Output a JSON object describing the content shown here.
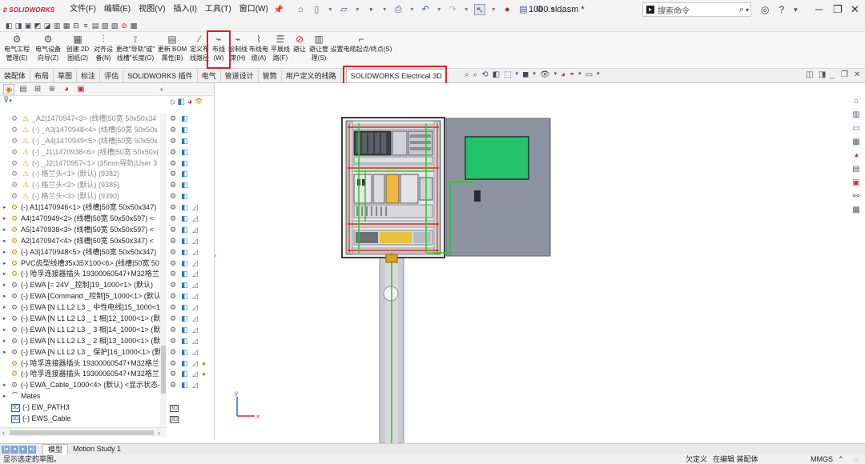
{
  "app": {
    "logo_text": "SOLIDWORKS",
    "document_title": "1000.sldasm *",
    "menus": [
      "文件(F)",
      "编辑(E)",
      "视图(V)",
      "插入(I)",
      "工具(T)",
      "窗口(W)"
    ],
    "search_placeholder": "搜索命令"
  },
  "ribbon": {
    "buttons": [
      {
        "label1": "电气工程",
        "label2": "管理(E)",
        "icon": "project-manager-icon"
      },
      {
        "label1": "电气设备",
        "label2": "向导(Z)",
        "icon": "device-wizard-icon"
      },
      {
        "label1": "创建 2D",
        "label2": "图纸(2)",
        "icon": "create-2d-drawing-icon"
      },
      {
        "label1": "对齐设",
        "label2": "备(N)",
        "icon": "align-device-icon"
      },
      {
        "label1": "更改\"导轨\"或\"",
        "label2": "线槽\"长度(G)",
        "icon": "change-length-icon"
      },
      {
        "label1": "更新 BOM",
        "label2": "属性(B)",
        "icon": "update-bom-icon"
      },
      {
        "label1": "定义布",
        "label2": "线路径",
        "icon": "define-route-icon"
      },
      {
        "label1": "布线",
        "label2": "(W)",
        "icon": "route-wires-icon"
      },
      {
        "label1": "绘制线",
        "label2": "束(H)",
        "icon": "draw-harness-icon"
      },
      {
        "label1": "布线电",
        "label2": "缆(A)",
        "icon": "route-cables-icon"
      },
      {
        "label1": "平展线",
        "label2": "路(F)",
        "icon": "flatten-route-icon"
      },
      {
        "label1": "避让",
        "label2": "",
        "icon": "avoid-icon"
      },
      {
        "label1": "避让管",
        "label2": "理(S)",
        "icon": "avoid-manager-icon"
      },
      {
        "label1": "设置电缆起点/终点(S)",
        "label2": "",
        "icon": "set-cable-endpoints-icon"
      }
    ]
  },
  "command_tabs": [
    "装配体",
    "布局",
    "草图",
    "标注",
    "评估",
    "SOLIDWORKS 插件",
    "电气",
    "管道设计",
    "管筒",
    "用户定义的线路",
    "SOLIDWORKS Electrical 3D"
  ],
  "active_command_tab": "SOLIDWORKS Electrical 3D",
  "tree": {
    "items": [
      {
        "exp": "",
        "warn": true,
        "text": "_A2|1470947<3> (线槽|50宽 50x50x34",
        "dim": true,
        "cols": 2
      },
      {
        "exp": "",
        "warn": true,
        "text": "(-) _A3|1470948<4> (线槽|50宽 50x50x",
        "dim": true,
        "cols": 2
      },
      {
        "exp": "",
        "warn": true,
        "text": "(-) _A4|1470949<5> (线槽|50宽 50x50x",
        "dim": true,
        "cols": 2
      },
      {
        "exp": "",
        "warn": true,
        "text": "(-) _J1|1470938<6> (线槽|50宽 50x50x(",
        "dim": true,
        "cols": 2
      },
      {
        "exp": "",
        "warn": true,
        "text": "(-) _J2|1470957<1> (35mm导轨|User 3",
        "dim": true,
        "cols": 2
      },
      {
        "exp": "",
        "warn": true,
        "text": "(-) 格兰头<1> (默认) (9382)",
        "dim": true,
        "cols": 2
      },
      {
        "exp": "",
        "warn": true,
        "text": "(-) 格兰头<2> (默认) (9385)",
        "dim": true,
        "cols": 2
      },
      {
        "exp": "",
        "warn": true,
        "text": "(-) 格兰头<3> (默认) (9390)",
        "dim": true,
        "cols": 2
      },
      {
        "exp": "▸",
        "warn": false,
        "text": "(-) A1|1470946<1> (线槽|50宽 50x50x347)",
        "dim": false,
        "cols": 3
      },
      {
        "exp": "▸",
        "warn": false,
        "text": "A4|1470949<2> (线槽|50宽 50x50x597) <",
        "dim": false,
        "cols": 3
      },
      {
        "exp": "▸",
        "warn": false,
        "text": "A5|1470938<3> (线槽|50宽 50x50x597) <",
        "dim": false,
        "cols": 3
      },
      {
        "exp": "▸",
        "warn": false,
        "text": "A2|1470947<4> (线槽|50宽 50x50x347) <",
        "dim": false,
        "cols": 3
      },
      {
        "exp": "▸",
        "warn": false,
        "text": "(-) A3|1470948<5> (线槽|50宽 50x50x347)",
        "dim": false,
        "cols": 3
      },
      {
        "exp": "▸",
        "warn": false,
        "text": "PVC齿型线槽35x35X100<6> (线槽|50宽 50",
        "dim": false,
        "cols": 3
      },
      {
        "exp": "▸",
        "warn": false,
        "text": "(-) 哈孚连接器插头 19300060547+M32格兰",
        "dim": false,
        "cols": 3
      },
      {
        "exp": "▸",
        "warn": false,
        "text": "(-) EWA [=  24V _控制]19_1000<1> (默认)",
        "dim": false,
        "cols": 3,
        "ewa": true
      },
      {
        "exp": "▸",
        "warn": false,
        "text": "(-) EWA [Command _控制]5_1000<1> (默认",
        "dim": false,
        "cols": 3,
        "ewa": true
      },
      {
        "exp": "▸",
        "warn": false,
        "text": "(-) EWA [N L1 L2 L3 _ 中性电线]15_1000<1",
        "dim": false,
        "cols": 3,
        "ewa": true
      },
      {
        "exp": "▸",
        "warn": false,
        "text": "(-) EWA [N L1 L2 L3 _ 1 相]12_1000<1> (默",
        "dim": false,
        "cols": 3,
        "ewa": true
      },
      {
        "exp": "▸",
        "warn": false,
        "text": "(-) EWA [N L1 L2 L3 _ 3 相]14_1000<1> (默",
        "dim": false,
        "cols": 3,
        "ewa": true
      },
      {
        "exp": "▸",
        "warn": false,
        "text": "(-) EWA [N L1 L2 L3 _ 2 相]13_1000<1> (默",
        "dim": false,
        "cols": 3,
        "ewa": true
      },
      {
        "exp": "▸",
        "warn": false,
        "text": "(-) EWA [N L1 L2 L3 _ 保护]16_1000<1> (默",
        "dim": false,
        "cols": 3,
        "ewa": true
      },
      {
        "exp": "",
        "warn": false,
        "text": "(-) 哈孚连接器插头 19300060547+M32格兰",
        "dim": false,
        "cols": 4
      },
      {
        "exp": "",
        "warn": false,
        "text": "(-) 哈孚连接器插头 19300060547+M32格兰",
        "dim": false,
        "cols": 4
      },
      {
        "exp": "▸",
        "warn": false,
        "text": "(-) EWA_Cable_1000<4> (默认) <显示状态-",
        "dim": false,
        "cols": 3,
        "ewa": true
      },
      {
        "exp": "▸",
        "warn": false,
        "text": "Mates",
        "dim": false,
        "cols": 0,
        "mates": true
      },
      {
        "exp": "",
        "warn": false,
        "text": "(-) EW_PATH3",
        "dim": false,
        "cols": 1,
        "sketch": true
      },
      {
        "exp": "",
        "warn": false,
        "text": "(-) EWS_Cable",
        "dim": false,
        "cols": 1,
        "sketch": true
      }
    ]
  },
  "bottom_tabs": [
    "模型",
    "Motion Study 1"
  ],
  "status": {
    "left": "显示选定的草图。",
    "mid1": "欠定义",
    "mid2": "在编辑 装配体",
    "units": "MMGS"
  },
  "colors": {
    "highlight": "#e02020",
    "wire_green": "#22cc22",
    "cabinet_gray": "#8d93a0",
    "screen_green": "#22c36a"
  }
}
